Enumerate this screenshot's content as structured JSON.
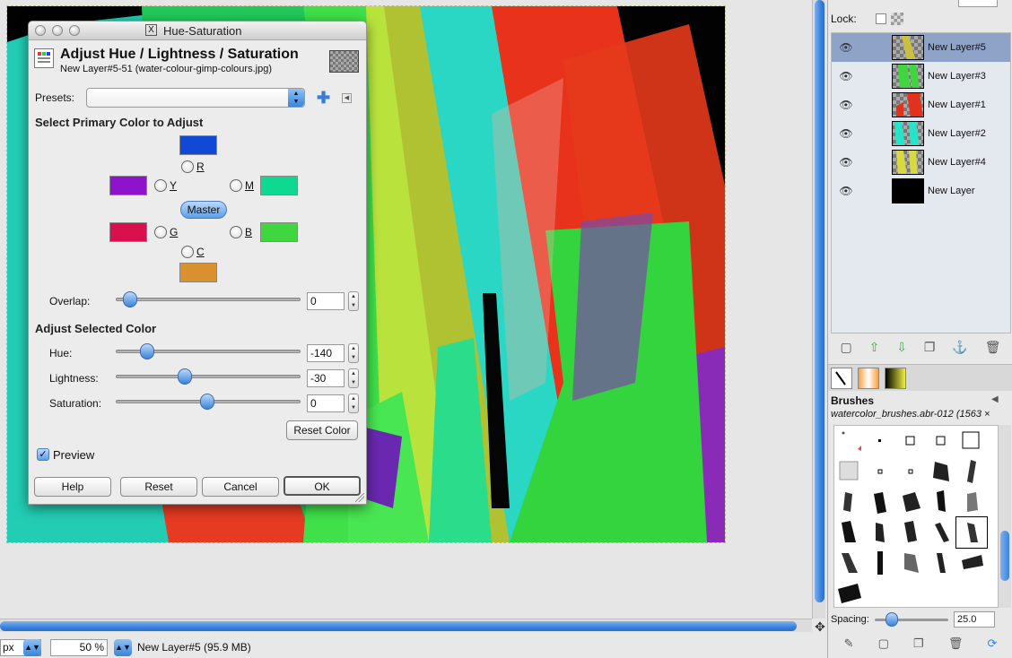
{
  "dialog": {
    "window_title": "Hue-Saturation",
    "header_title": "Adjust Hue / Lightness / Saturation",
    "header_subtitle": "New Layer#5-51 (water-colour-gimp-colours.jpg)",
    "presets_label": "Presets:",
    "presets_value": "",
    "primary_section": "Select Primary Color to Adjust",
    "colors": {
      "R": {
        "label": "R",
        "swatch": "#1149d6"
      },
      "Y": {
        "label": "Y",
        "swatch": "#8f12cc"
      },
      "M": {
        "label": "M",
        "swatch": "#0ed992"
      },
      "G": {
        "label": "G",
        "swatch": "#d90f4e"
      },
      "B": {
        "label": "B",
        "swatch": "#3fd640"
      },
      "C": {
        "label": "C",
        "swatch": "#d9902f"
      }
    },
    "master_label": "Master",
    "overlap_label": "Overlap:",
    "overlap_value": "0",
    "adjust_section": "Adjust Selected Color",
    "hue_label": "Hue:",
    "hue_value": "-140",
    "lightness_label": "Lightness:",
    "lightness_value": "-30",
    "saturation_label": "Saturation:",
    "saturation_value": "0",
    "reset_color_label": "Reset Color",
    "preview_label": "Preview",
    "preview_checked": true,
    "help_label": "Help",
    "reset_label": "Reset",
    "cancel_label": "Cancel",
    "ok_label": "OK"
  },
  "layers": {
    "lock_label": "Lock:",
    "items": [
      {
        "name": "New Layer#5",
        "selected": true
      },
      {
        "name": "New Layer#3",
        "selected": false
      },
      {
        "name": "New Layer#1",
        "selected": false
      },
      {
        "name": "New Layer#2",
        "selected": false
      },
      {
        "name": "New Layer#4",
        "selected": false
      },
      {
        "name": "New Layer",
        "selected": false
      }
    ]
  },
  "brushes": {
    "title": "Brushes",
    "current_brush": "watercolor_brushes.abr-012 (1563 ×",
    "spacing_label": "Spacing:",
    "spacing_value": "25.0"
  },
  "status": {
    "unit": "px",
    "zoom": "50 %",
    "info": "New Layer#5 (95.9 MB)"
  },
  "colors": {
    "accent": "#3b83db",
    "selected_layer": "#8fa3c8"
  }
}
